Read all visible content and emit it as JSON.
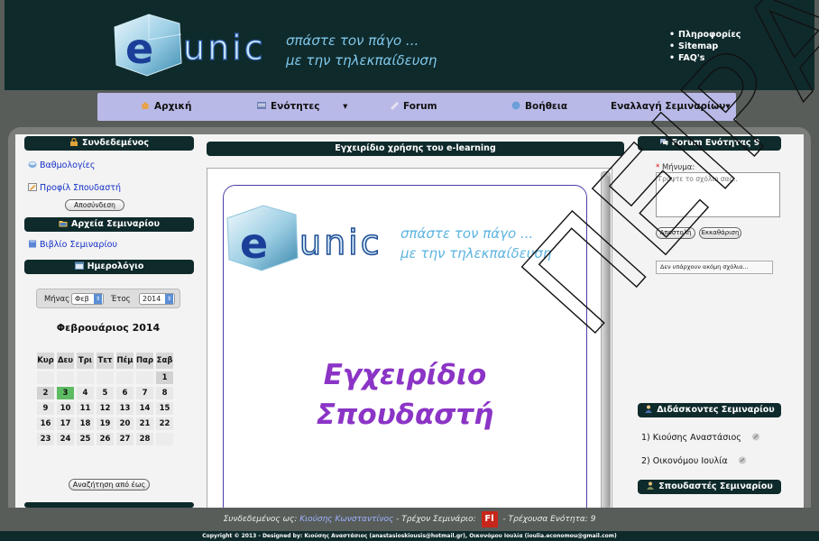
{
  "header": {
    "logo_word": "unic",
    "logo_letter": "e",
    "slogan_line1": "σπάστε τον πάγο ...",
    "slogan_line2": "με την τηλεκπαίδευση",
    "top_links": [
      "Πληροφορίες",
      "Sitemap",
      "FAQ's"
    ]
  },
  "nav": {
    "home": "Αρχική",
    "units": "Ενότητες",
    "units_caret": "▾",
    "forum": "Forum",
    "help": "Βοήθεια",
    "switch": "Εναλλαγή Σεμιναρίων▾"
  },
  "left": {
    "logged_in_title": "Συνδεδεμένος",
    "grades": "Βαθμολογίες",
    "profile": "Προφίλ Σπουδαστή",
    "logout": "Αποσύνδεση",
    "files_title": "Αρχεία Σεμιναρίου",
    "book": "Βιβλίο Σεμιναρίου",
    "calendar_title": "Ημερολόγιο",
    "month_label": "Μήνας",
    "month_value": "Φεβ",
    "year_label": "Έτος",
    "year_value": "2014",
    "calendar_heading": "Φεβρουάριος 2014",
    "weekdays": [
      "Κυρ",
      "Δευ",
      "Τρι",
      "Τετ",
      "Πέμ",
      "Παρ",
      "Σαβ"
    ],
    "weeks": [
      [
        "",
        "",
        "",
        "",
        "",
        "",
        "1"
      ],
      [
        "2",
        "3",
        "4",
        "5",
        "6",
        "7",
        "8"
      ],
      [
        "9",
        "10",
        "11",
        "12",
        "13",
        "14",
        "15"
      ],
      [
        "16",
        "17",
        "18",
        "19",
        "20",
        "21",
        "22"
      ],
      [
        "23",
        "24",
        "25",
        "26",
        "27",
        "28",
        ""
      ]
    ],
    "today": "3",
    "search_range": "Αναζήτηση από έως"
  },
  "center": {
    "title": "Εγχειρίδιο χρήσης του e-learning",
    "manual_line1": "Εγχειρίδιο",
    "manual_line2": "Σπουδαστή"
  },
  "right": {
    "forum_title": "Forum Ενότητας 9",
    "message_label": "Μήνυμα:",
    "message_required": "*",
    "message_placeholder": "Γράψτε το σχόλιο σας..",
    "send": "Αποστολή",
    "clear": "Εκκαθάριση",
    "no_comments": "Δεν υπάρχουν ακόμη σχόλια...",
    "teachers_title": "Διδάσκοντες Σεμιναρίου",
    "teachers": [
      "1) Κιούσης Αναστάσιος",
      "2) Οικονόμου Ιουλία"
    ],
    "students_title": "Σπουδαστές Σεμιναρίου"
  },
  "footer": {
    "prefix": "Συνδεδεμένος ως:",
    "user": "Κιούσης Κωνσταντίνος",
    "seminar_prefix": "- Τρέχον Σεμινάριο:",
    "seminar_badge": "Fl",
    "unit_text": "- Τρέχουσα Ενότητα: 9",
    "copyright": "Copyright © 2013 - Designed by: Κιούσης Αναστάσιος (anastasioskiousis@hotmail.gr), Οικονόμου Ιουλία (ioulia.economou@gmail.com)"
  },
  "watermark": "ΠΕΙΡΑΙΩΣ",
  "colors": {
    "header_bg": "#0f2a2b",
    "nav_bg": "#b9b9e8",
    "link": "#1430c8",
    "manual_title": "#8b34c6",
    "today_cell": "#5dbb63"
  }
}
